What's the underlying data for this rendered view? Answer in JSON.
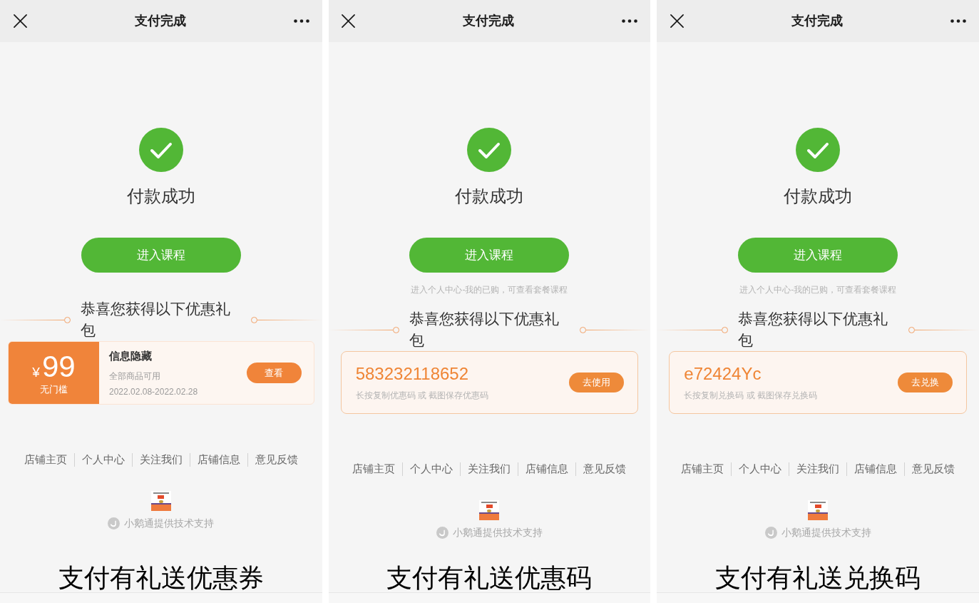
{
  "panels": [
    {
      "nav_bar": {
        "title": "支付完成"
      },
      "status": "付款成功",
      "primary_button": "进入课程",
      "gift_heading": "恭喜您获得以下优惠礼包",
      "gift": {
        "kind": "coupon",
        "currency": "¥",
        "amount": "99",
        "condition": "无门槛",
        "title": "信息隐藏",
        "scope": "全部商品可用",
        "validity": "2022.02.08-2022.02.28",
        "button": "查看"
      },
      "footer_links": [
        "店铺主页",
        "个人中心",
        "关注我们",
        "店铺信息",
        "意见反馈"
      ],
      "support_text": "小鹅通提供技术支持",
      "caption": "支付有礼送优惠券"
    },
    {
      "nav_bar": {
        "title": "支付完成"
      },
      "status": "付款成功",
      "primary_button": "进入课程",
      "hint": "进入个人中心-我的已购，可查看套餐课程",
      "gift_heading": "恭喜您获得以下优惠礼包",
      "gift": {
        "kind": "code",
        "code": "583232118652",
        "instruction": "长按复制优惠码 或 截图保存优惠码",
        "button": "去使用"
      },
      "footer_links": [
        "店铺主页",
        "个人中心",
        "关注我们",
        "店铺信息",
        "意见反馈"
      ],
      "support_text": "小鹅通提供技术支持",
      "caption": "支付有礼送优惠码"
    },
    {
      "nav_bar": {
        "title": "支付完成"
      },
      "status": "付款成功",
      "primary_button": "进入课程",
      "hint": "进入个人中心-我的已购，可查看套餐课程",
      "gift_heading": "恭喜您获得以下优惠礼包",
      "gift": {
        "kind": "code",
        "code": "e72424Yc",
        "instruction": "长按复制兑换码 或 截图保存兑换码",
        "button": "去兑换"
      },
      "footer_links": [
        "店铺主页",
        "个人中心",
        "关注我们",
        "店铺信息",
        "意见反馈"
      ],
      "support_text": "小鹅通提供技术支持",
      "caption": "支付有礼送兑换码"
    }
  ]
}
